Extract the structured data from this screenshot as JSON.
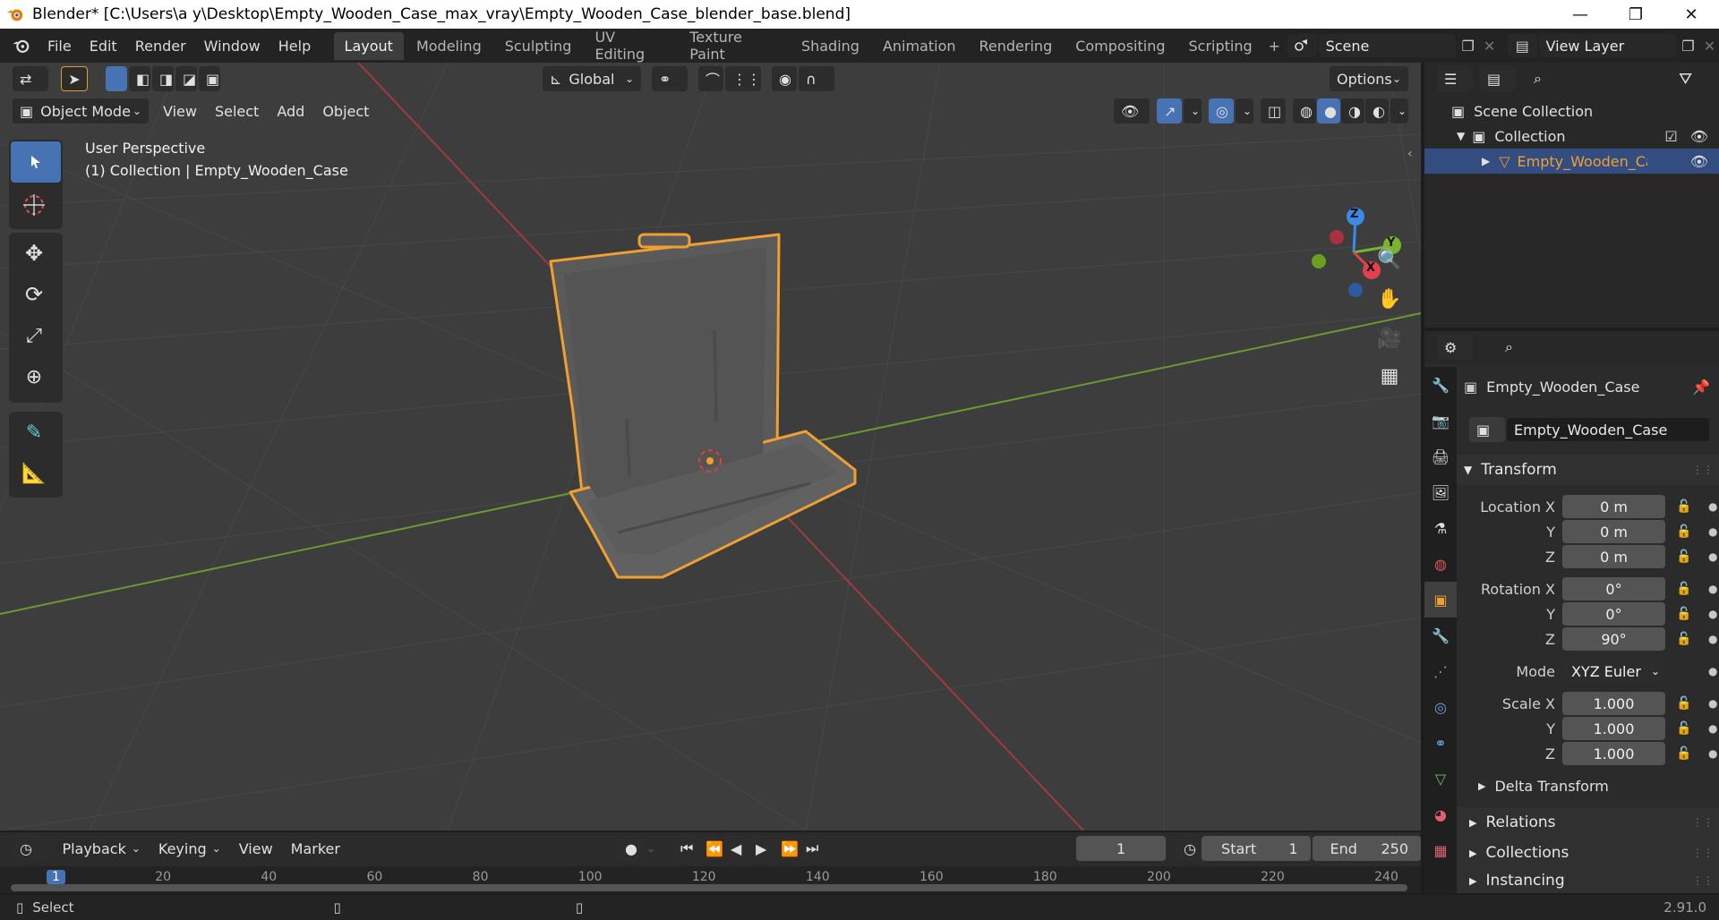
{
  "window": {
    "title": "Blender* [C:\\Users\\a y\\Desktop\\Empty_Wooden_Case_max_vray\\Empty_Wooden_Case_blender_base.blend]",
    "minimize_glyph": "—",
    "maximize_glyph": "❐",
    "close_glyph": "✕"
  },
  "menu": {
    "items": [
      "File",
      "Edit",
      "Render",
      "Window",
      "Help"
    ]
  },
  "workspaces": {
    "tabs": [
      "Layout",
      "Modeling",
      "Sculpting",
      "UV Editing",
      "Texture Paint",
      "Shading",
      "Animation",
      "Rendering",
      "Compositing",
      "Scripting"
    ],
    "active": "Layout",
    "add_glyph": "+"
  },
  "scene": {
    "name": "Scene"
  },
  "view_layer": {
    "name": "View Layer"
  },
  "viewport_header": {
    "transform_orientation": "Global",
    "options_label": "Options",
    "mode": "Object Mode",
    "menus": [
      "View",
      "Select",
      "Add",
      "Object"
    ]
  },
  "viewport_overlay": {
    "perspective": "User Perspective",
    "collection_line": "(1) Collection | Empty_Wooden_Case"
  },
  "gizmo": {
    "z": "Z",
    "y": "Y",
    "x": "X"
  },
  "outliner": {
    "scene_collection": "Scene Collection",
    "collection": "Collection",
    "object": "Empty_Wooden_Case"
  },
  "properties": {
    "object_name": "Empty_Wooden_Case",
    "data_name": "Empty_Wooden_Case",
    "transform_title": "Transform",
    "location": {
      "label_x": "Location X",
      "label_y": "Y",
      "label_z": "Z",
      "x": "0 m",
      "y": "0 m",
      "z": "0 m"
    },
    "rotation": {
      "label_x": "Rotation X",
      "label_y": "Y",
      "label_z": "Z",
      "x": "0°",
      "y": "0°",
      "z": "90°"
    },
    "mode": {
      "label": "Mode",
      "value": "XYZ Euler"
    },
    "scale": {
      "label_x": "Scale X",
      "label_y": "Y",
      "label_z": "Z",
      "x": "1.000",
      "y": "1.000",
      "z": "1.000"
    },
    "subpanels": [
      "Delta Transform",
      "Relations",
      "Collections",
      "Instancing"
    ]
  },
  "timeline": {
    "menus": [
      "Playback",
      "Keying",
      "View",
      "Marker"
    ],
    "current_frame": "1",
    "start_label": "Start",
    "start": "1",
    "end_label": "End",
    "end": "250",
    "ruler_ticks": [
      "1",
      "20",
      "40",
      "60",
      "80",
      "100",
      "120",
      "140",
      "160",
      "180",
      "200",
      "220",
      "240"
    ]
  },
  "statusbar": {
    "left": "Select",
    "version": "2.91.0"
  },
  "colors": {
    "accent": "#4772b3",
    "selection_outline": "#f0a030",
    "x_axis": "#a03a40",
    "y_axis": "#6a9a30",
    "gizmo_x": "#e0404f",
    "gizmo_y": "#7ab42c",
    "gizmo_z": "#3a8be6"
  }
}
